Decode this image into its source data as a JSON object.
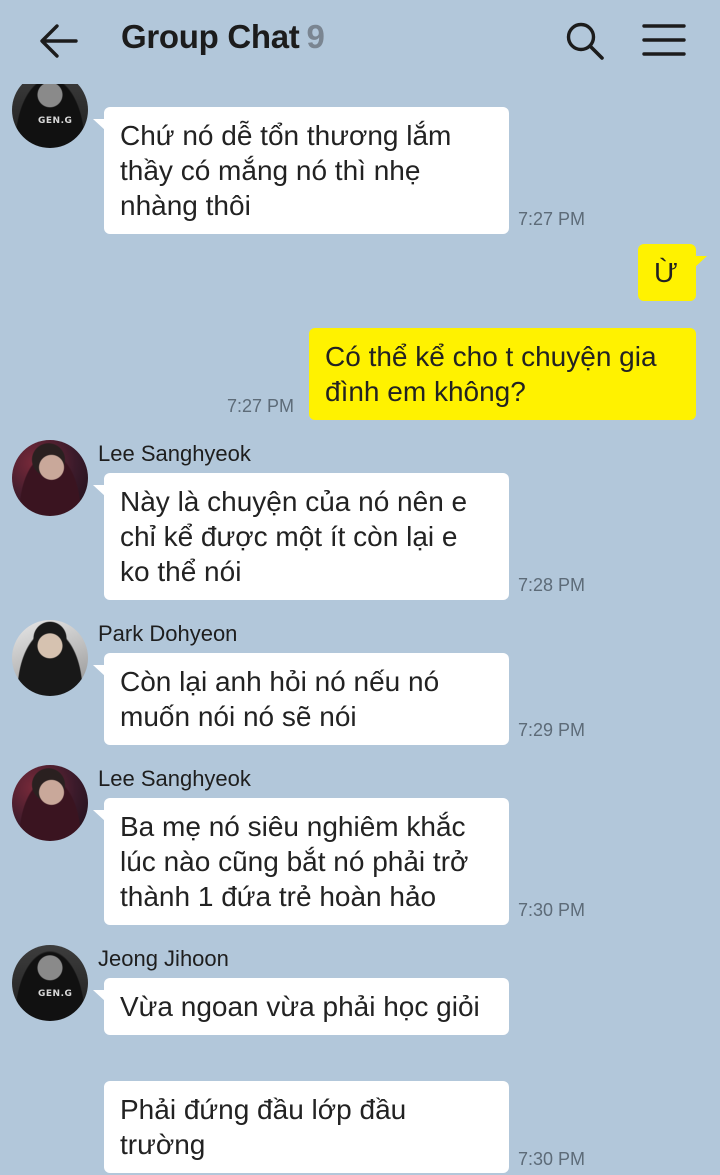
{
  "header": {
    "back_icon": "arrow-left-icon",
    "title": "Group Chat",
    "member_count": "9",
    "search_icon": "search-icon",
    "menu_icon": "hamburger-menu-icon"
  },
  "colors": {
    "background": "#b2c7da",
    "my_bubble": "#fff200",
    "other_bubble": "#ffffff",
    "time_text": "#5d6b78",
    "member_count": "#7a8591"
  },
  "messages": [
    {
      "sender": "",
      "side": "left",
      "text": "Chứ nó dễ tổn thương lắm thầy có mắng nó thì nhẹ nhàng thôi",
      "time": "7:27 PM"
    },
    {
      "sender": "me",
      "side": "right",
      "text": "Ừ",
      "time": ""
    },
    {
      "sender": "me",
      "side": "right",
      "text": "Có thể kể cho t chuyện gia đình em không?",
      "time": "7:27 PM"
    },
    {
      "sender": "Lee Sanghyeok",
      "side": "left",
      "text": "Này là chuyện của nó nên e chỉ kể được một ít còn lại e ko thể nói",
      "time": "7:28 PM"
    },
    {
      "sender": "Park Dohyeon",
      "side": "left",
      "text": "Còn lại anh hỏi nó nếu nó muốn nói nó sẽ nói",
      "time": "7:29 PM"
    },
    {
      "sender": "Lee Sanghyeok",
      "side": "left",
      "text": "Ba mẹ nó siêu nghiêm khắc lúc nào cũng bắt nó phải trở thành 1 đứa trẻ hoàn hảo",
      "time": "7:30 PM"
    },
    {
      "sender": "Jeong Jihoon",
      "side": "left",
      "text": "Vừa ngoan vừa phải học giỏi",
      "time": ""
    },
    {
      "sender": "Jeong Jihoon",
      "side": "left",
      "text": "Phải đứng đầu lớp đầu trường",
      "time": "7:30 PM"
    }
  ],
  "avatar_labels": {
    "jersey": "GEN.G"
  }
}
